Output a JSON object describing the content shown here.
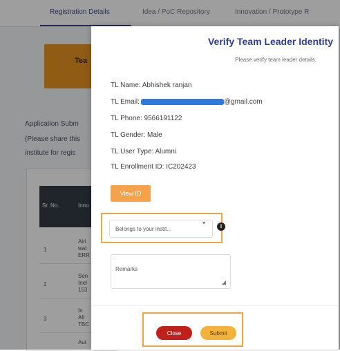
{
  "tabs": [
    "Registration Details",
    "Idea / PoC Repository",
    "Innovation / Prototype R"
  ],
  "background": {
    "card_label": "Tea",
    "lines": [
      "Application Subm",
      "(Please share this",
      "institute for regis"
    ],
    "table_headers": [
      "Sr. No.",
      "Inno"
    ],
    "table_rows": [
      {
        "no": "1",
        "text": [
          "Airi",
          "wat",
          "ERR"
        ]
      },
      {
        "no": "2",
        "text": [
          "Sen",
          "Inel",
          "153"
        ]
      },
      {
        "no": "3",
        "text": [
          "In",
          "All",
          "TBC"
        ]
      },
      {
        "no": "",
        "text": [
          "Aut"
        ]
      }
    ]
  },
  "modal": {
    "title": "Verify Team Leader Identity",
    "subtitle": "Please verify team leader details.",
    "tl_name": "TL Name: Abhishek ranjan",
    "tl_email_prefix": "TL Email:",
    "tl_email_suffix": "@gmail.com",
    "tl_phone": "TL Phone: 9566191122",
    "tl_gender": "TL Gender: Male",
    "tl_user_type": "TL User Type: Alumni",
    "tl_enrollment": "TL Enrollment ID: IC202423",
    "view_id_label": "View ID",
    "select_value": "Belongs to your instit...",
    "remarks_placeholder": "Remarks",
    "close_label": "Close",
    "submit_label": "Submit"
  },
  "colors": {
    "accent_blue": "#2d3e8c",
    "highlight_orange": "#f3a53c",
    "close_red": "#c0211b",
    "submit_yellow": "#f3b23c",
    "view_orange": "#f5a24a"
  },
  "icons": [
    "chevron-down-icon",
    "info-icon",
    "resize-handle-icon"
  ]
}
